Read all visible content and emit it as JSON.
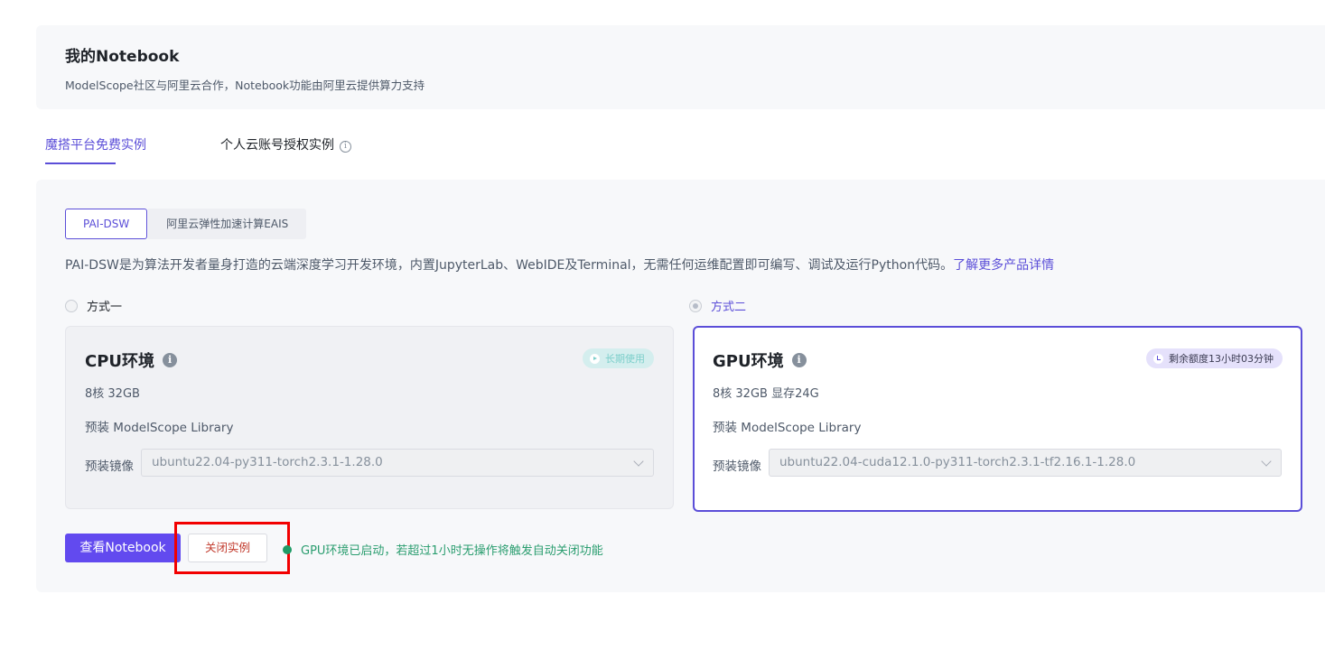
{
  "header": {
    "title": "我的Notebook",
    "subtitle": "ModelScope社区与阿里云合作，Notebook功能由阿里云提供算力支持"
  },
  "tabs": [
    {
      "label": "魔搭平台免费实例",
      "active": true
    },
    {
      "label": "个人云账号授权实例",
      "active": false,
      "icon": "info-icon"
    }
  ],
  "segments": [
    {
      "label": "PAI-DSW",
      "active": true
    },
    {
      "label": "阿里云弹性加速计算EAIS",
      "active": false
    }
  ],
  "description": {
    "text": "PAI-DSW是为算法开发者量身打造的云端深度学习开发环境，内置JupyterLab、WebIDE及Terminal，无需任何运维配置即可编写、调试及运行Python代码。",
    "link": "了解更多产品详情"
  },
  "options": [
    {
      "radio_label": "方式一",
      "selected": false,
      "title": "CPU环境",
      "badge": "长期使用",
      "spec": "8核 32GB",
      "library": "预装 ModelScope Library",
      "image_label": "预装镜像",
      "image_value": "ubuntu22.04-py311-torch2.3.1-1.28.0"
    },
    {
      "radio_label": "方式二",
      "selected": true,
      "title": "GPU环境",
      "badge": "剩余额度13小时03分钟",
      "spec": "8核 32GB 显存24G",
      "library": "预装 ModelScope Library",
      "image_label": "预装镜像",
      "image_value": "ubuntu22.04-cuda12.1.0-py311-torch2.3.1-tf2.16.1-1.28.0"
    }
  ],
  "actions": {
    "view_label": "查看Notebook",
    "close_label": "关闭实例",
    "status_text": "GPU环境已启动，若超过1小时无操作将触发自动关闭功能"
  },
  "colors": {
    "accent": "#5b4ed8",
    "primary_button": "#624aef",
    "status": "#2a9d6f",
    "highlight_frame": "#f20000"
  }
}
